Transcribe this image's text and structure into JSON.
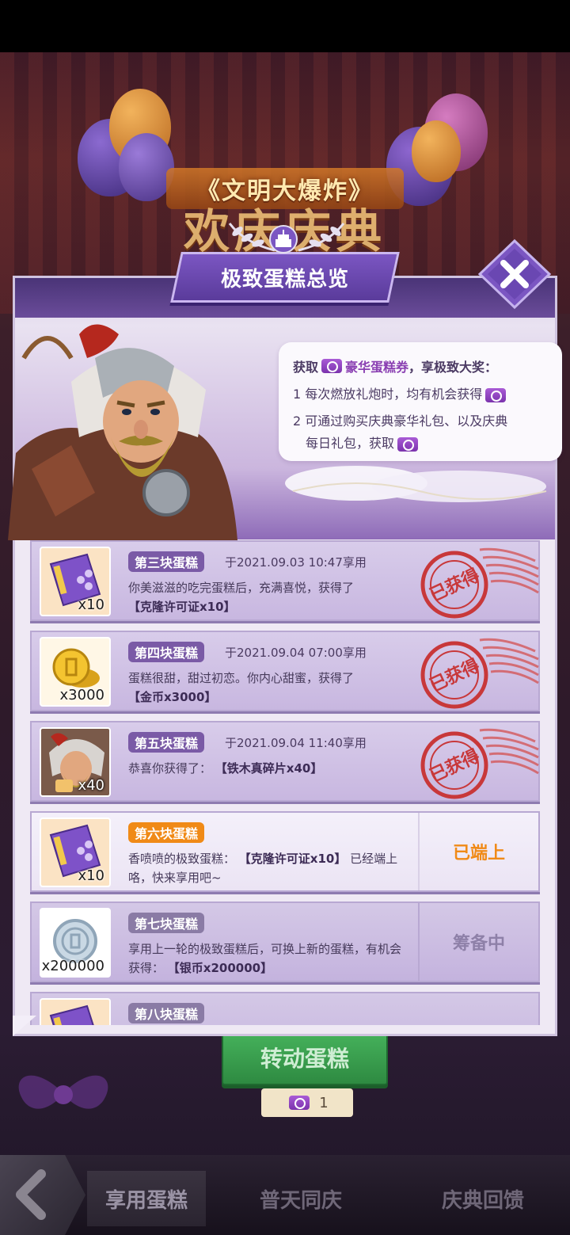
{
  "scene": {
    "banner_text": "《文明大爆炸》",
    "big_title": "欢庆庆典"
  },
  "modal": {
    "title": "极致蛋糕总览",
    "close_icon": "close-x-icon",
    "info": {
      "head_prefix": "获取",
      "head_highlight": "豪华蛋糕券",
      "head_suffix": "，享极致大奖：",
      "line1": "1 每次燃放礼炮时，均有机会获得",
      "line2": "2 可通过购买庆典豪华礼包、以及庆典",
      "line3": "每日礼包，获取"
    },
    "rows": [
      {
        "tag": "第三块蛋糕",
        "time": "于2021.09.03 10:47享用",
        "desc": "你美滋滋的吃完蛋糕后，充满喜悦，获得了",
        "reward": "【克隆许可证x10】",
        "qty": "x10",
        "icon": "clone-license-icon",
        "stamp": "已获得"
      },
      {
        "tag": "第四块蛋糕",
        "time": "于2021.09.04 07:00享用",
        "desc": "蛋糕很甜，甜过初恋。你内心甜蜜，获得了",
        "reward": "【金币x3000】",
        "qty": "x3000",
        "icon": "gold-coin-icon",
        "stamp": "已获得"
      },
      {
        "tag": "第五块蛋糕",
        "time": "于2021.09.04 11:40享用",
        "desc": "恭喜你获得了：",
        "reward": "【铁木真碎片x40】",
        "qty": "x40",
        "icon": "hero-fragment-icon",
        "stamp": "已获得"
      },
      {
        "tag": "第六块蛋糕",
        "desc_prefix": "香喷喷的极致蛋糕：",
        "reward": "【克隆许可证x10】",
        "desc_suffix": "已经端上咯，快来享用吧~",
        "qty": "x10",
        "icon": "clone-license-icon",
        "status": "已端上"
      },
      {
        "tag": "第七块蛋糕",
        "desc": "享用上一轮的极致蛋糕后，可换上新的蛋糕，有机会获得：",
        "reward": "【银币x200000】",
        "qty": "x200000",
        "icon": "silver-coin-icon",
        "status": "筹备中"
      },
      {
        "tag": "第八块蛋糕",
        "icon": "clone-license-icon"
      }
    ]
  },
  "spin": {
    "label": "转动蛋糕",
    "count": "1"
  },
  "nav": {
    "tabs": [
      "享用蛋糕",
      "普天同庆",
      "庆典回馈"
    ]
  },
  "colors": {
    "accent_orange": "#f08a17",
    "tag_purple": "#7a5aa6",
    "stamp_red": "#c8383a",
    "spin_green": "#2e8a41"
  }
}
